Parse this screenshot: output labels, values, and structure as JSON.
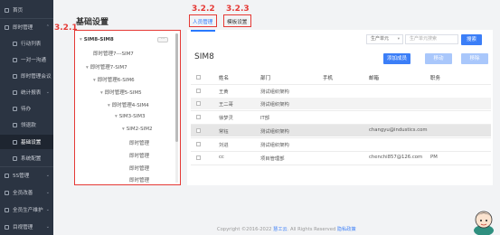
{
  "sidebar": {
    "items": [
      {
        "label": "首页",
        "type": "top",
        "chevron": ""
      },
      {
        "label": "即时管理",
        "type": "top",
        "chevron": "⌃"
      },
      {
        "label": "行动列表",
        "type": "sub",
        "chevron": ""
      },
      {
        "label": "一对一沟通",
        "type": "sub",
        "chevron": ""
      },
      {
        "label": "即时管理会议",
        "type": "sub",
        "chevron": ""
      },
      {
        "label": "统计报表",
        "type": "sub",
        "chevron": "⌄"
      },
      {
        "label": "待办",
        "type": "sub",
        "chevron": ""
      },
      {
        "label": "领退款",
        "type": "sub",
        "chevron": ""
      },
      {
        "label": "基础设置",
        "type": "sub-active",
        "chevron": ""
      },
      {
        "label": "系统配置",
        "type": "sub",
        "chevron": ""
      },
      {
        "label": "5S管理",
        "type": "top",
        "chevron": "⌄"
      },
      {
        "label": "全员改善",
        "type": "top",
        "chevron": "⌄"
      },
      {
        "label": "全员生产维护",
        "type": "top",
        "chevron": "⌄"
      },
      {
        "label": "目视管理",
        "type": "top",
        "chevron": "⌄"
      }
    ]
  },
  "page": {
    "title": "基础设置"
  },
  "annotations": {
    "tree": "3.2.1",
    "tab_people": "3.2.2",
    "tab_template": "3.2.3"
  },
  "tabs": [
    {
      "label": "人员管理",
      "active": true
    },
    {
      "label": "模板设置",
      "active": false
    }
  ],
  "tree": {
    "more_label": "···",
    "nodes": [
      {
        "label": "SIM8-SIM8",
        "toggle": "▾",
        "level": 0,
        "selected": true
      },
      {
        "label": "即时管理7---SIM7",
        "toggle": "",
        "level": 1,
        "selected": false
      },
      {
        "label": "即时管理7-SIM7",
        "toggle": "▾",
        "level": 1,
        "selected": false
      },
      {
        "label": "即时管理6-SIM6",
        "toggle": "▾",
        "level": 2,
        "selected": false
      },
      {
        "label": "即时管理5-SIM5",
        "toggle": "▾",
        "level": 3,
        "selected": false
      },
      {
        "label": "即时管理4-SIM4",
        "toggle": "▾",
        "level": 4,
        "selected": false
      },
      {
        "label": "SIM3-SIM3",
        "toggle": "▾",
        "level": 5,
        "selected": false
      },
      {
        "label": "SIM2-SIM2",
        "toggle": "▾",
        "level": 6,
        "selected": false
      },
      {
        "label": "即时管理",
        "toggle": "",
        "level": 7,
        "selected": false
      },
      {
        "label": "即时管理",
        "toggle": "",
        "level": 7,
        "selected": false
      },
      {
        "label": "即时管理",
        "toggle": "",
        "level": 7,
        "selected": false
      },
      {
        "label": "即时管理",
        "toggle": "",
        "level": 7,
        "selected": false
      }
    ]
  },
  "filters": {
    "unit_select": "生产单元",
    "search_placeholder": "生产单元搜索",
    "search_button": "搜索"
  },
  "group": {
    "title": "SIM8"
  },
  "actions": {
    "add": "添加成员",
    "move": "移动",
    "remove": "移除"
  },
  "table": {
    "headers": [
      "姓名",
      "部门",
      "手机",
      "邮箱",
      "职务"
    ],
    "rows": [
      {
        "name": "王黄",
        "dept": "测试组织架构",
        "phone": "",
        "email": "",
        "title": "",
        "style": "plain"
      },
      {
        "name": "王二哥",
        "dept": "测试组织架构",
        "phone": "",
        "email": "",
        "title": "",
        "style": "alt"
      },
      {
        "name": "徐梦灵",
        "dept": "IT部",
        "phone": "",
        "email": "",
        "title": "",
        "style": "plain"
      },
      {
        "name": "常钰",
        "dept": "测试组织架构",
        "phone": "",
        "email": "changyu@industics.com",
        "title": "",
        "style": "sel"
      },
      {
        "name": "刘进",
        "dept": "测试组织架构",
        "phone": "",
        "email": "",
        "title": "",
        "style": "plain"
      },
      {
        "name": "cc",
        "dept": "项目管理部",
        "phone": "",
        "email": "chenchi857@126.com",
        "title": "PM",
        "style": "plain"
      }
    ]
  },
  "footer": {
    "copyright": "Copyright ©2016-2022",
    "company": "慧工云",
    "rights": ". All Rights Reserved",
    "privacy": "隐私政策"
  },
  "colors": {
    "sidebar_bg": "#2b3442",
    "accent": "#3b7ef7",
    "annotation": "#e53935"
  }
}
